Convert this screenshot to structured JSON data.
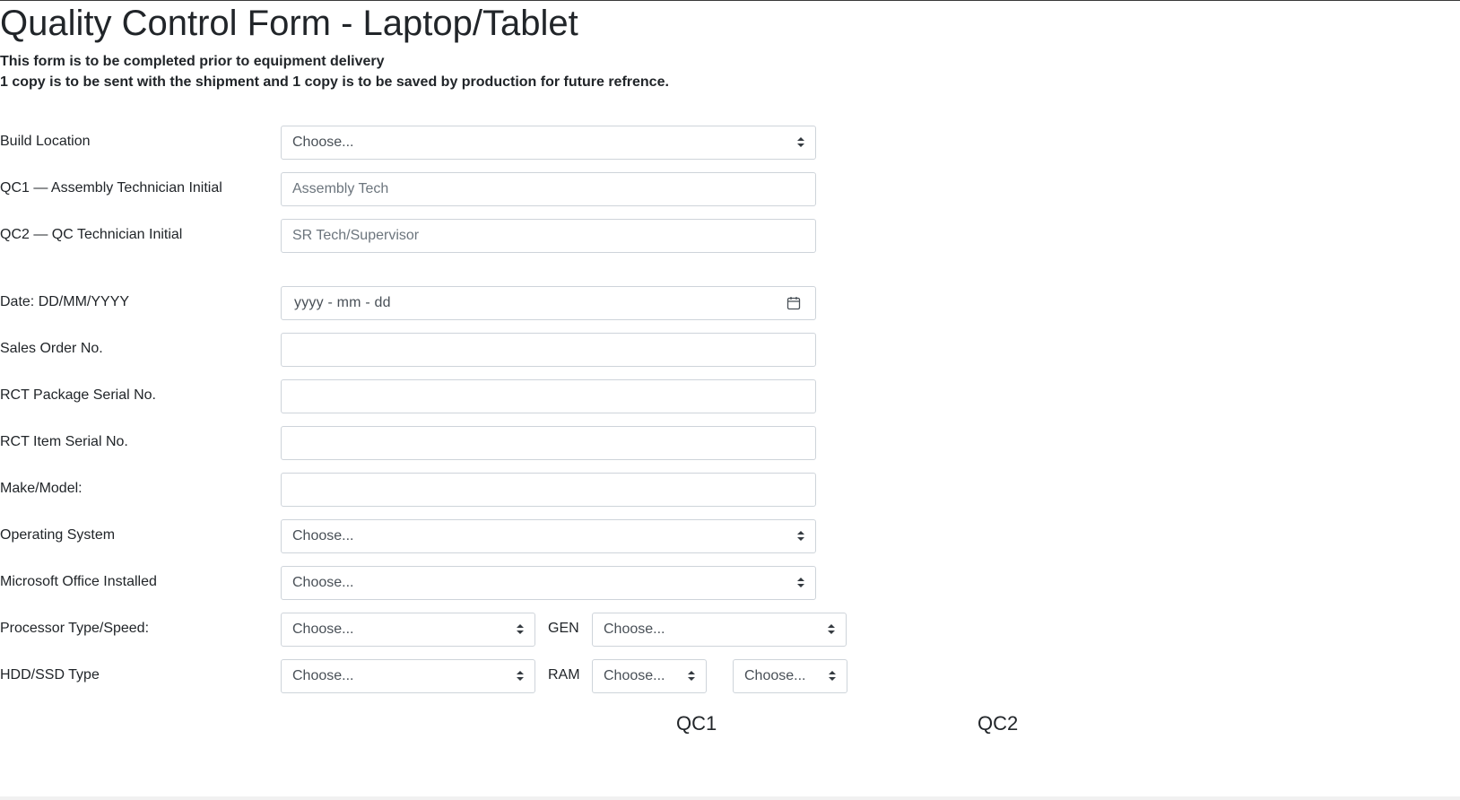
{
  "form": {
    "title": "Quality Control Form - Laptop/Tablet",
    "intro_line_1": "This form is to be completed prior to equipment delivery",
    "intro_line_2": "1 copy is to be sent with the shipment and 1 copy is to be saved by production for future refrence."
  },
  "fields": {
    "build_location": {
      "label": "Build Location",
      "value": "Choose..."
    },
    "qc1_initial": {
      "label": "QC1 — Assembly Technician Initial",
      "value": "",
      "placeholder": "Assembly Tech"
    },
    "qc2_initial": {
      "label": "QC2 — QC Technician Initial",
      "value": "",
      "placeholder": "SR Tech/Supervisor"
    },
    "date": {
      "label": "Date: DD/MM/YYYY",
      "value": "yyyy - mm - dd"
    },
    "sales_order": {
      "label": "Sales Order No.",
      "value": ""
    },
    "rct_package_serial": {
      "label": "RCT Package Serial No.",
      "value": ""
    },
    "rct_item_serial": {
      "label": "RCT Item Serial No.",
      "value": ""
    },
    "make_model": {
      "label": "Make/Model:",
      "value": ""
    },
    "operating_system": {
      "label": "Operating System",
      "value": "Choose..."
    },
    "ms_office": {
      "label": "Microsoft Office Installed",
      "value": "Choose..."
    },
    "processor": {
      "label": "Processor Type/Speed:",
      "value": "Choose...",
      "gen_label": "GEN",
      "gen_value": "Choose..."
    },
    "storage": {
      "label": "HDD/SSD Type",
      "value": "Choose...",
      "ram_label": "RAM",
      "ram_value": "Choose...",
      "ram_value_2": "Choose..."
    }
  },
  "columns": {
    "qc1": "QC1",
    "qc2": "QC2"
  },
  "icons": {
    "select_arrow": "chevron-up-down-icon",
    "date_picker": "calendar-icon"
  },
  "colors": {
    "text": "#212529",
    "border": "#ced4da",
    "placeholder": "#6c757d"
  }
}
